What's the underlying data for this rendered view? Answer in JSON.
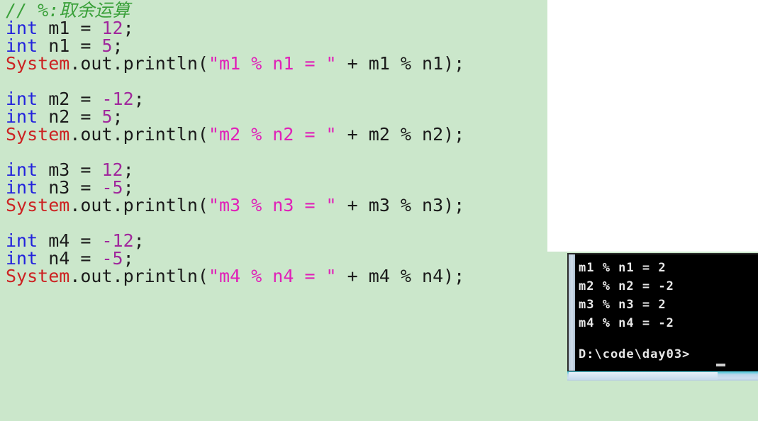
{
  "editor": {
    "background_color": "#cbe7cb",
    "comment_color": "#3aa03a",
    "keyword_color": "#2222dd",
    "type_color": "#cc2222",
    "number_color": "#a0289c",
    "string_color": "#e020b8",
    "lines": [
      {
        "segments": [
          {
            "text": "// %:取余运算",
            "cls": "tok-comment"
          }
        ]
      },
      {
        "segments": [
          {
            "text": "int",
            "cls": "tok-kw"
          },
          {
            "text": " m1 = ",
            "cls": "tok-plain"
          },
          {
            "text": "12",
            "cls": "tok-num"
          },
          {
            "text": ";",
            "cls": "tok-punct"
          }
        ]
      },
      {
        "segments": [
          {
            "text": "int",
            "cls": "tok-kw"
          },
          {
            "text": " n1 = ",
            "cls": "tok-plain"
          },
          {
            "text": "5",
            "cls": "tok-num"
          },
          {
            "text": ";",
            "cls": "tok-punct"
          }
        ]
      },
      {
        "segments": [
          {
            "text": "System",
            "cls": "tok-type"
          },
          {
            "text": ".out.println(",
            "cls": "tok-plain"
          },
          {
            "text": "\"m1 % n1 = \"",
            "cls": "tok-str"
          },
          {
            "text": " + m1 % n1);",
            "cls": "tok-plain"
          }
        ]
      },
      {
        "segments": [
          {
            "text": "",
            "cls": "tok-plain"
          }
        ]
      },
      {
        "segments": [
          {
            "text": "int",
            "cls": "tok-kw"
          },
          {
            "text": " m2 = ",
            "cls": "tok-plain"
          },
          {
            "text": "-12",
            "cls": "tok-num"
          },
          {
            "text": ";",
            "cls": "tok-punct"
          }
        ]
      },
      {
        "segments": [
          {
            "text": "int",
            "cls": "tok-kw"
          },
          {
            "text": " n2 = ",
            "cls": "tok-plain"
          },
          {
            "text": "5",
            "cls": "tok-num"
          },
          {
            "text": ";",
            "cls": "tok-punct"
          }
        ]
      },
      {
        "segments": [
          {
            "text": "System",
            "cls": "tok-type"
          },
          {
            "text": ".out.println(",
            "cls": "tok-plain"
          },
          {
            "text": "\"m2 % n2 = \"",
            "cls": "tok-str"
          },
          {
            "text": " + m2 % n2);",
            "cls": "tok-plain"
          }
        ]
      },
      {
        "segments": [
          {
            "text": "",
            "cls": "tok-plain"
          }
        ]
      },
      {
        "segments": [
          {
            "text": "int",
            "cls": "tok-kw"
          },
          {
            "text": " m3 = ",
            "cls": "tok-plain"
          },
          {
            "text": "12",
            "cls": "tok-num"
          },
          {
            "text": ";",
            "cls": "tok-punct"
          }
        ]
      },
      {
        "segments": [
          {
            "text": "int",
            "cls": "tok-kw"
          },
          {
            "text": " n3 = ",
            "cls": "tok-plain"
          },
          {
            "text": "-5",
            "cls": "tok-num"
          },
          {
            "text": ";",
            "cls": "tok-punct"
          }
        ]
      },
      {
        "segments": [
          {
            "text": "System",
            "cls": "tok-type"
          },
          {
            "text": ".out.println(",
            "cls": "tok-plain"
          },
          {
            "text": "\"m3 % n3 = \"",
            "cls": "tok-str"
          },
          {
            "text": " + m3 % n3);",
            "cls": "tok-plain"
          }
        ]
      },
      {
        "segments": [
          {
            "text": "",
            "cls": "tok-plain"
          }
        ]
      },
      {
        "segments": [
          {
            "text": "int",
            "cls": "tok-kw"
          },
          {
            "text": " m4 = ",
            "cls": "tok-plain"
          },
          {
            "text": "-12",
            "cls": "tok-num"
          },
          {
            "text": ";",
            "cls": "tok-punct"
          }
        ]
      },
      {
        "segments": [
          {
            "text": "int",
            "cls": "tok-kw"
          },
          {
            "text": " n4 = ",
            "cls": "tok-plain"
          },
          {
            "text": "-5",
            "cls": "tok-num"
          },
          {
            "text": ";",
            "cls": "tok-punct"
          }
        ]
      },
      {
        "segments": [
          {
            "text": "System",
            "cls": "tok-type"
          },
          {
            "text": ".out.println(",
            "cls": "tok-plain"
          },
          {
            "text": "\"m4 % n4 = \"",
            "cls": "tok-str"
          },
          {
            "text": " + m4 % n4);",
            "cls": "tok-plain"
          }
        ]
      }
    ]
  },
  "console": {
    "background_color": "#000000",
    "text_color": "#e8e8e8",
    "output_lines": [
      "m1 % n1 = 2",
      "m2 % n2 = -2",
      "m3 % n3 = 2",
      "m4 % n4 = -2"
    ],
    "blank_line": "",
    "prompt": "D:\\code\\day03>"
  }
}
